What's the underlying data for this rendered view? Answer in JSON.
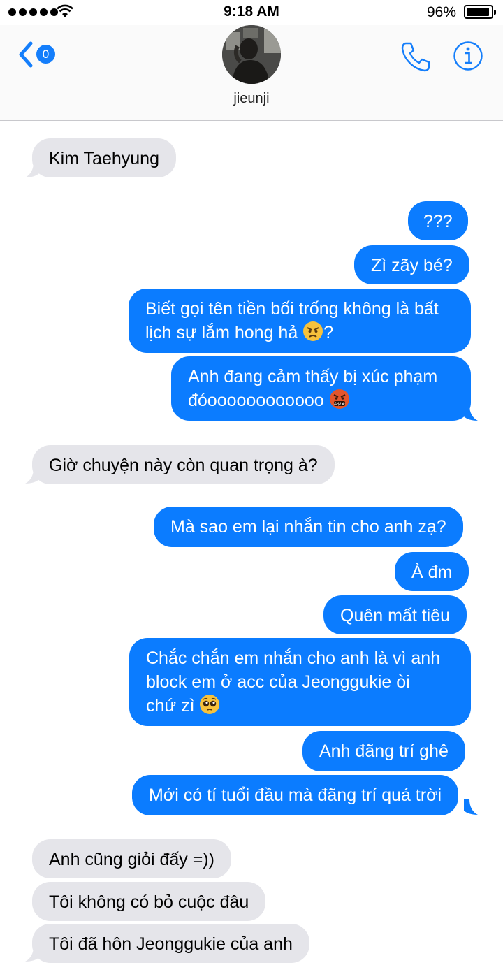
{
  "status_bar": {
    "time": "9:18 AM",
    "battery": "96%"
  },
  "header": {
    "back_badge": "0",
    "contact_name": "jieunji"
  },
  "messages": [
    {
      "text": "Kim Taehyung"
    },
    {
      "text": "???"
    },
    {
      "text": "Zì zãy bé?"
    },
    {
      "line1": "Biết gọi tên tiền bối trống không là bất",
      "line2": "lịch sự lắm hong hả",
      "line2_end": "?",
      "emoji": "angry-face"
    },
    {
      "line1": "Anh đang cảm thấy bị xúc phạm",
      "line2": "đóoooooooooooo",
      "emoji": "face-with-symbols-on-mouth"
    },
    {
      "text": "Giờ chuyện này còn quan trọng à?"
    },
    {
      "text": "Mà sao em lại nhắn tin cho anh zạ?"
    },
    {
      "text": "À đm"
    },
    {
      "text": "Quên mất tiêu"
    },
    {
      "line1": "Chắc chắn em nhắn cho anh là vì anh",
      "line2": "block em ở acc của Jeonggukie òi",
      "line3": "chứ zì",
      "emoji": "pleading-face"
    },
    {
      "text": "Anh đãng trí ghê"
    },
    {
      "text": "Mới có tí tuổi đầu mà đãng trí quá trời"
    },
    {
      "text": "Anh cũng giỏi đấy =))"
    },
    {
      "text": "Tôi không có bỏ cuộc đâu"
    },
    {
      "text": "Tôi đã hôn Jeonggukie của anh"
    }
  ],
  "colors": {
    "accent": "#147efb",
    "outgoing": "#0b7cff",
    "incoming": "#e5e5ea"
  }
}
